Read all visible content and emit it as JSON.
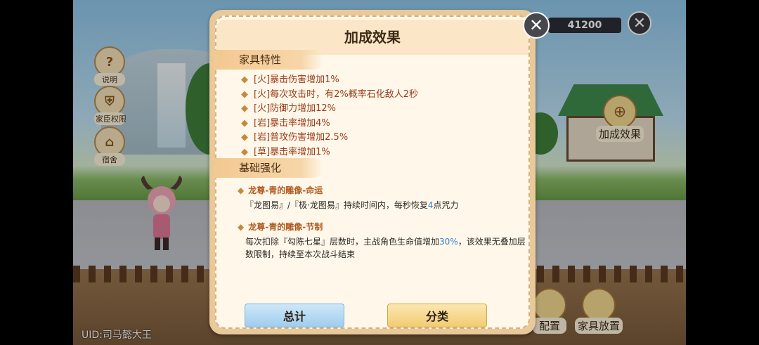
{
  "hud": {
    "coins": "41200",
    "close_glyph": "✕",
    "uid": "UID:司马懿大王",
    "side_buttons": [
      {
        "label": "说明",
        "glyph": "?"
      },
      {
        "label": "家臣权限",
        "glyph": "⛨"
      },
      {
        "label": "宿舍",
        "glyph": "⌂"
      }
    ],
    "bonus_label": "加成效果",
    "bottom_buttons": [
      {
        "label": "配置"
      },
      {
        "label": "家具放置"
      }
    ]
  },
  "dialog": {
    "title": "加成效果",
    "close_glyph": "✕",
    "section1_title": "家具特性",
    "traits": [
      "[火]暴击伤害增加1%",
      "[火]每次攻击时，有2%概率石化敌人2秒",
      "[火]防御力增加12%",
      "[岩]暴击率增加4%",
      "[岩]普攻伤害增加2.5%",
      "[草]暴击率增加1%"
    ],
    "section2_title": "基础强化",
    "enhancements": [
      {
        "name": "龙尊-青的雕像-命运",
        "desc_pre": "『龙图易』/『极·龙图易』持续时间内，每秒恢复",
        "desc_num": "4",
        "desc_post": "点咒力"
      },
      {
        "name": "龙尊-青的雕像-节制",
        "desc_pre": "每次扣除『勾陈七星』层数时，主战角色生命值增加",
        "desc_num": "30%",
        "desc_post": "，该效果无叠加层数限制，持续至本次战斗结束"
      }
    ],
    "btn_total": "总计",
    "btn_category": "分类"
  }
}
